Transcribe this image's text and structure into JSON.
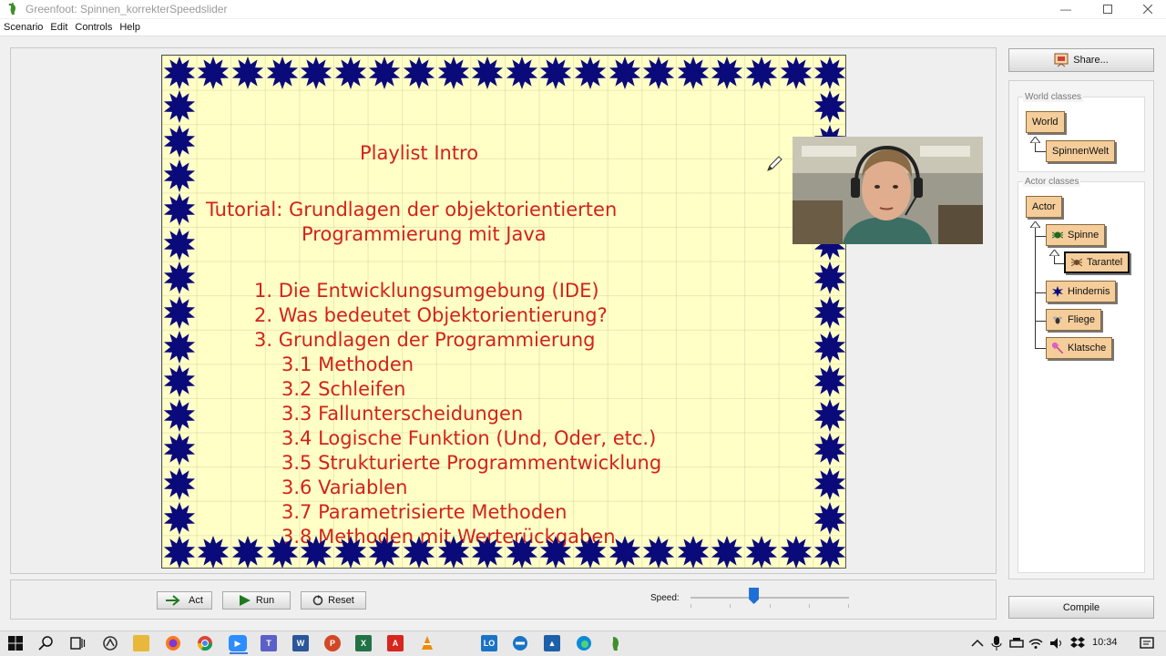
{
  "window": {
    "title": "Greenfoot: Spinnen_korrekterSpeedslider",
    "controls": [
      "minimize-icon",
      "maximize-icon",
      "close-icon"
    ]
  },
  "menu": [
    "Scenario",
    "Edit",
    "Controls",
    "Help"
  ],
  "slide": {
    "heading": "Playlist Intro",
    "tutorial_line1": "Tutorial: Grundlagen der objektorientierten",
    "tutorial_line2": "Programmierung mit Java",
    "items": [
      "1. Die Entwicklungsumgebung (IDE)",
      "2. Was bedeutet Objektorientierung?",
      "3. Grundlagen der Programmierung",
      "3.1 Methoden",
      "3.2 Schleifen",
      "3.3 Fallunterscheidungen",
      "3.4 Logische Funktion (Und, Oder, etc.)",
      "3.5 Strukturierte Programmentwicklung",
      "3.6 Variablen",
      "3.7 Parametrisierte Methoden",
      "3.8 Methoden mit Werterückgaben"
    ],
    "text_color": "#d3221a",
    "star_color": "#0a0a7a",
    "background_color": "#ffffc6"
  },
  "controls": {
    "act_label": "Act",
    "run_label": "Run",
    "reset_label": "Reset",
    "speed_label": "Speed:",
    "speed_value": 0.4
  },
  "side": {
    "share_label": "Share...",
    "world_classes_label": "World classes",
    "world_classes": [
      "World",
      "SpinnenWelt"
    ],
    "actor_classes_label": "Actor classes",
    "actor_classes": [
      "Actor",
      "Spinne",
      "Tarantel",
      "Hindernis",
      "Fliege",
      "Klatsche"
    ],
    "selected_class": "Tarantel",
    "compile_label": "Compile"
  },
  "taskbar": {
    "apps": [
      "windows-start-icon",
      "search-icon",
      "task-view-icon",
      "app-icon",
      "file-explorer-icon",
      "firefox-icon",
      "chrome-icon",
      "zoom-icon",
      "teams-icon",
      "word-icon",
      "powerpoint-icon",
      "excel-icon",
      "acrobat-icon",
      "vlc-icon",
      "lo-icon",
      "app-icon-2",
      "whiteboard-icon",
      "edge-icon",
      "greenfoot-icon"
    ],
    "time": "10:34"
  }
}
